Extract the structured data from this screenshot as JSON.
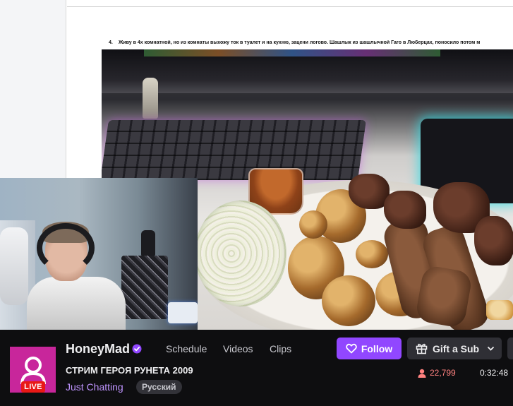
{
  "document": {
    "line_number": "4.",
    "line_text": "Живу в 4х комнатной, но из комнаты выхожу ток в туалет и на кухню, зацени логово. Шашлык из шашлычной Гаго в Люберцах, поносило потом м"
  },
  "channel": {
    "name": "HoneyMad",
    "verified": true,
    "avatar_color": "#c8269b",
    "live_label": "LIVE"
  },
  "nav": {
    "schedule": "Schedule",
    "videos": "Videos",
    "clips": "Clips"
  },
  "actions": {
    "follow": "Follow",
    "gift_sub": "Gift a Sub"
  },
  "stream": {
    "title": "СТРИМ ГЕРОЯ РУНЕТА 2009",
    "category": "Just Chatting",
    "language": "Русский",
    "viewers": "22,799",
    "uptime": "0:32:48"
  },
  "colors": {
    "accent": "#9147ff",
    "live": "#e91916",
    "viewers": "#ff8280",
    "category": "#bf94ff"
  }
}
